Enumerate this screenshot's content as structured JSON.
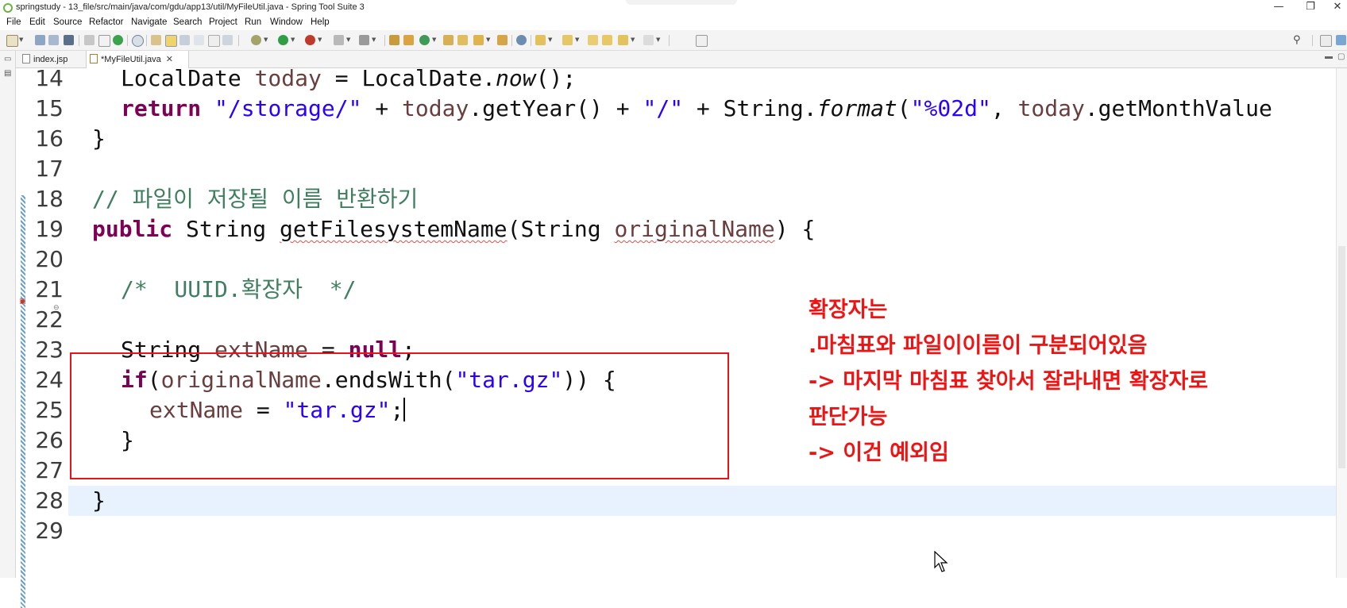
{
  "window": {
    "title": "springstudy - 13_file/src/main/java/com/gdu/app13/util/MyFileUtil.java - Spring Tool Suite 3",
    "controls": {
      "minimize": "—",
      "restore": "❐",
      "close": "✕"
    }
  },
  "menu": [
    "File",
    "Edit",
    "Source",
    "Refactor",
    "Navigate",
    "Search",
    "Project",
    "Run",
    "Window",
    "Help"
  ],
  "toolbar": {
    "icons": [
      "new-icon",
      "save-icon",
      "save-all-icon",
      "print-icon",
      "toggle-breakpoint-icon",
      "skip-breakpoints-icon",
      "debug-icon",
      "refresh-icon",
      "open-type-icon",
      "mark-occurrences-icon",
      "block-selection-icon",
      "toggle-whitespace-icon",
      "show-paragraph-icon",
      "debug-run-icon",
      "run-icon",
      "external-tools-icon",
      "coverage-icon",
      "server-icon",
      "spring-icon",
      "new-java-project-icon",
      "new-package-icon",
      "new-class-icon",
      "open-task-icon",
      "search-task-icon",
      "globe-icon",
      "next-annotation-icon",
      "prev-annotation-icon",
      "last-edit-icon",
      "back-icon",
      "forward-icon",
      "pin-editor-icon"
    ],
    "search_icon": "search-icon",
    "perspective_icon": "open-perspective-icon"
  },
  "tabs": [
    {
      "label": "index.jsp",
      "active": false
    },
    {
      "label": "*MyFileUtil.java",
      "active": true,
      "close": "✕"
    }
  ],
  "editor": {
    "lines": [
      {
        "num": "14"
      },
      {
        "num": "15"
      },
      {
        "num": "16"
      },
      {
        "num": "17"
      },
      {
        "num": "18"
      },
      {
        "num": "19"
      },
      {
        "num": "20"
      },
      {
        "num": "21"
      },
      {
        "num": "22"
      },
      {
        "num": "23"
      },
      {
        "num": "24"
      },
      {
        "num": "25"
      },
      {
        "num": "26"
      },
      {
        "num": "27"
      },
      {
        "num": "28"
      },
      {
        "num": "29"
      }
    ],
    "code": {
      "l14": {
        "a": "LocalDate ",
        "b": "today",
        "c": " = LocalDate.",
        "d": "now",
        "e": "();"
      },
      "l15": {
        "kw": "return",
        "s1": " \"/storage/\"",
        "p1": " + ",
        "f1": "today",
        "p2": ".getYear() + ",
        "s2": "\"/\"",
        "p3": " + String.",
        "fmt": "format",
        "p4": "(",
        "s3": "\"%02d\"",
        "p5": ", ",
        "f2": "today",
        "p6": ".getMonthValue"
      },
      "l16": "}",
      "l18": "// 파일이 저장될 이름 반환하기",
      "l19": {
        "kw": "public",
        "p1": " String ",
        "m": "getFilesystemName",
        "p2": "(String ",
        "v": "originalName",
        "p3": ") {"
      },
      "l21": "/*  UUID.확장자  */",
      "l23": {
        "p1": "String ",
        "v": "extName",
        "p2": " = ",
        "kw": "null",
        "p3": ";"
      },
      "l24": {
        "kw": "if",
        "p1": "(",
        "v": "originalName",
        "p2": ".endsWith(",
        "s": "\"tar.gz\"",
        "p3": ")) {"
      },
      "l25": {
        "v": "extName",
        "p1": " = ",
        "s": "\"tar.gz\"",
        "p2": ";"
      },
      "l26": "}",
      "l28": "}"
    }
  },
  "annotation": {
    "lines": [
      "확장자는",
      ".마침표와 파일이이름이 구분되어있음",
      "-> 마지막 마침표 찾아서 잘라내면 확장자로",
      "판단가능",
      "-> 이건 예외임"
    ],
    "color": "#ee1414"
  }
}
